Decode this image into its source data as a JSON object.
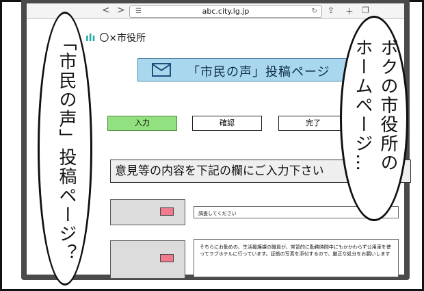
{
  "browser": {
    "url": "abc.city.lg.jp",
    "back_icon": "<",
    "forward_icon": ">"
  },
  "site": {
    "logo_text": "〇×市役所"
  },
  "banner": {
    "title": "「市民の声」投稿ページ"
  },
  "steps": [
    {
      "label": "入力",
      "active": true
    },
    {
      "label": "確認",
      "active": false
    },
    {
      "label": "完了",
      "active": false
    }
  ],
  "form": {
    "section_title": "意見等の内容を下記の欄にご入力下さい",
    "field1_value": "調査してください",
    "field2_value": "そちらにお勤めの、生活援護課の職員が、常習的に勤務時間中にもかかわらず公用車を使ってラブホテルに行っています。証拠の写真を添付するので、厳正な処分をお願いします"
  },
  "bubbles": {
    "left": "「市民の声」投稿ページ？",
    "right_line1": "ボクの市役所の",
    "right_line2": "ホームページ…"
  },
  "colors": {
    "banner_bg": "#a9d8ee",
    "active_step": "#92e07f",
    "required_mark": "#ef7b8c"
  }
}
